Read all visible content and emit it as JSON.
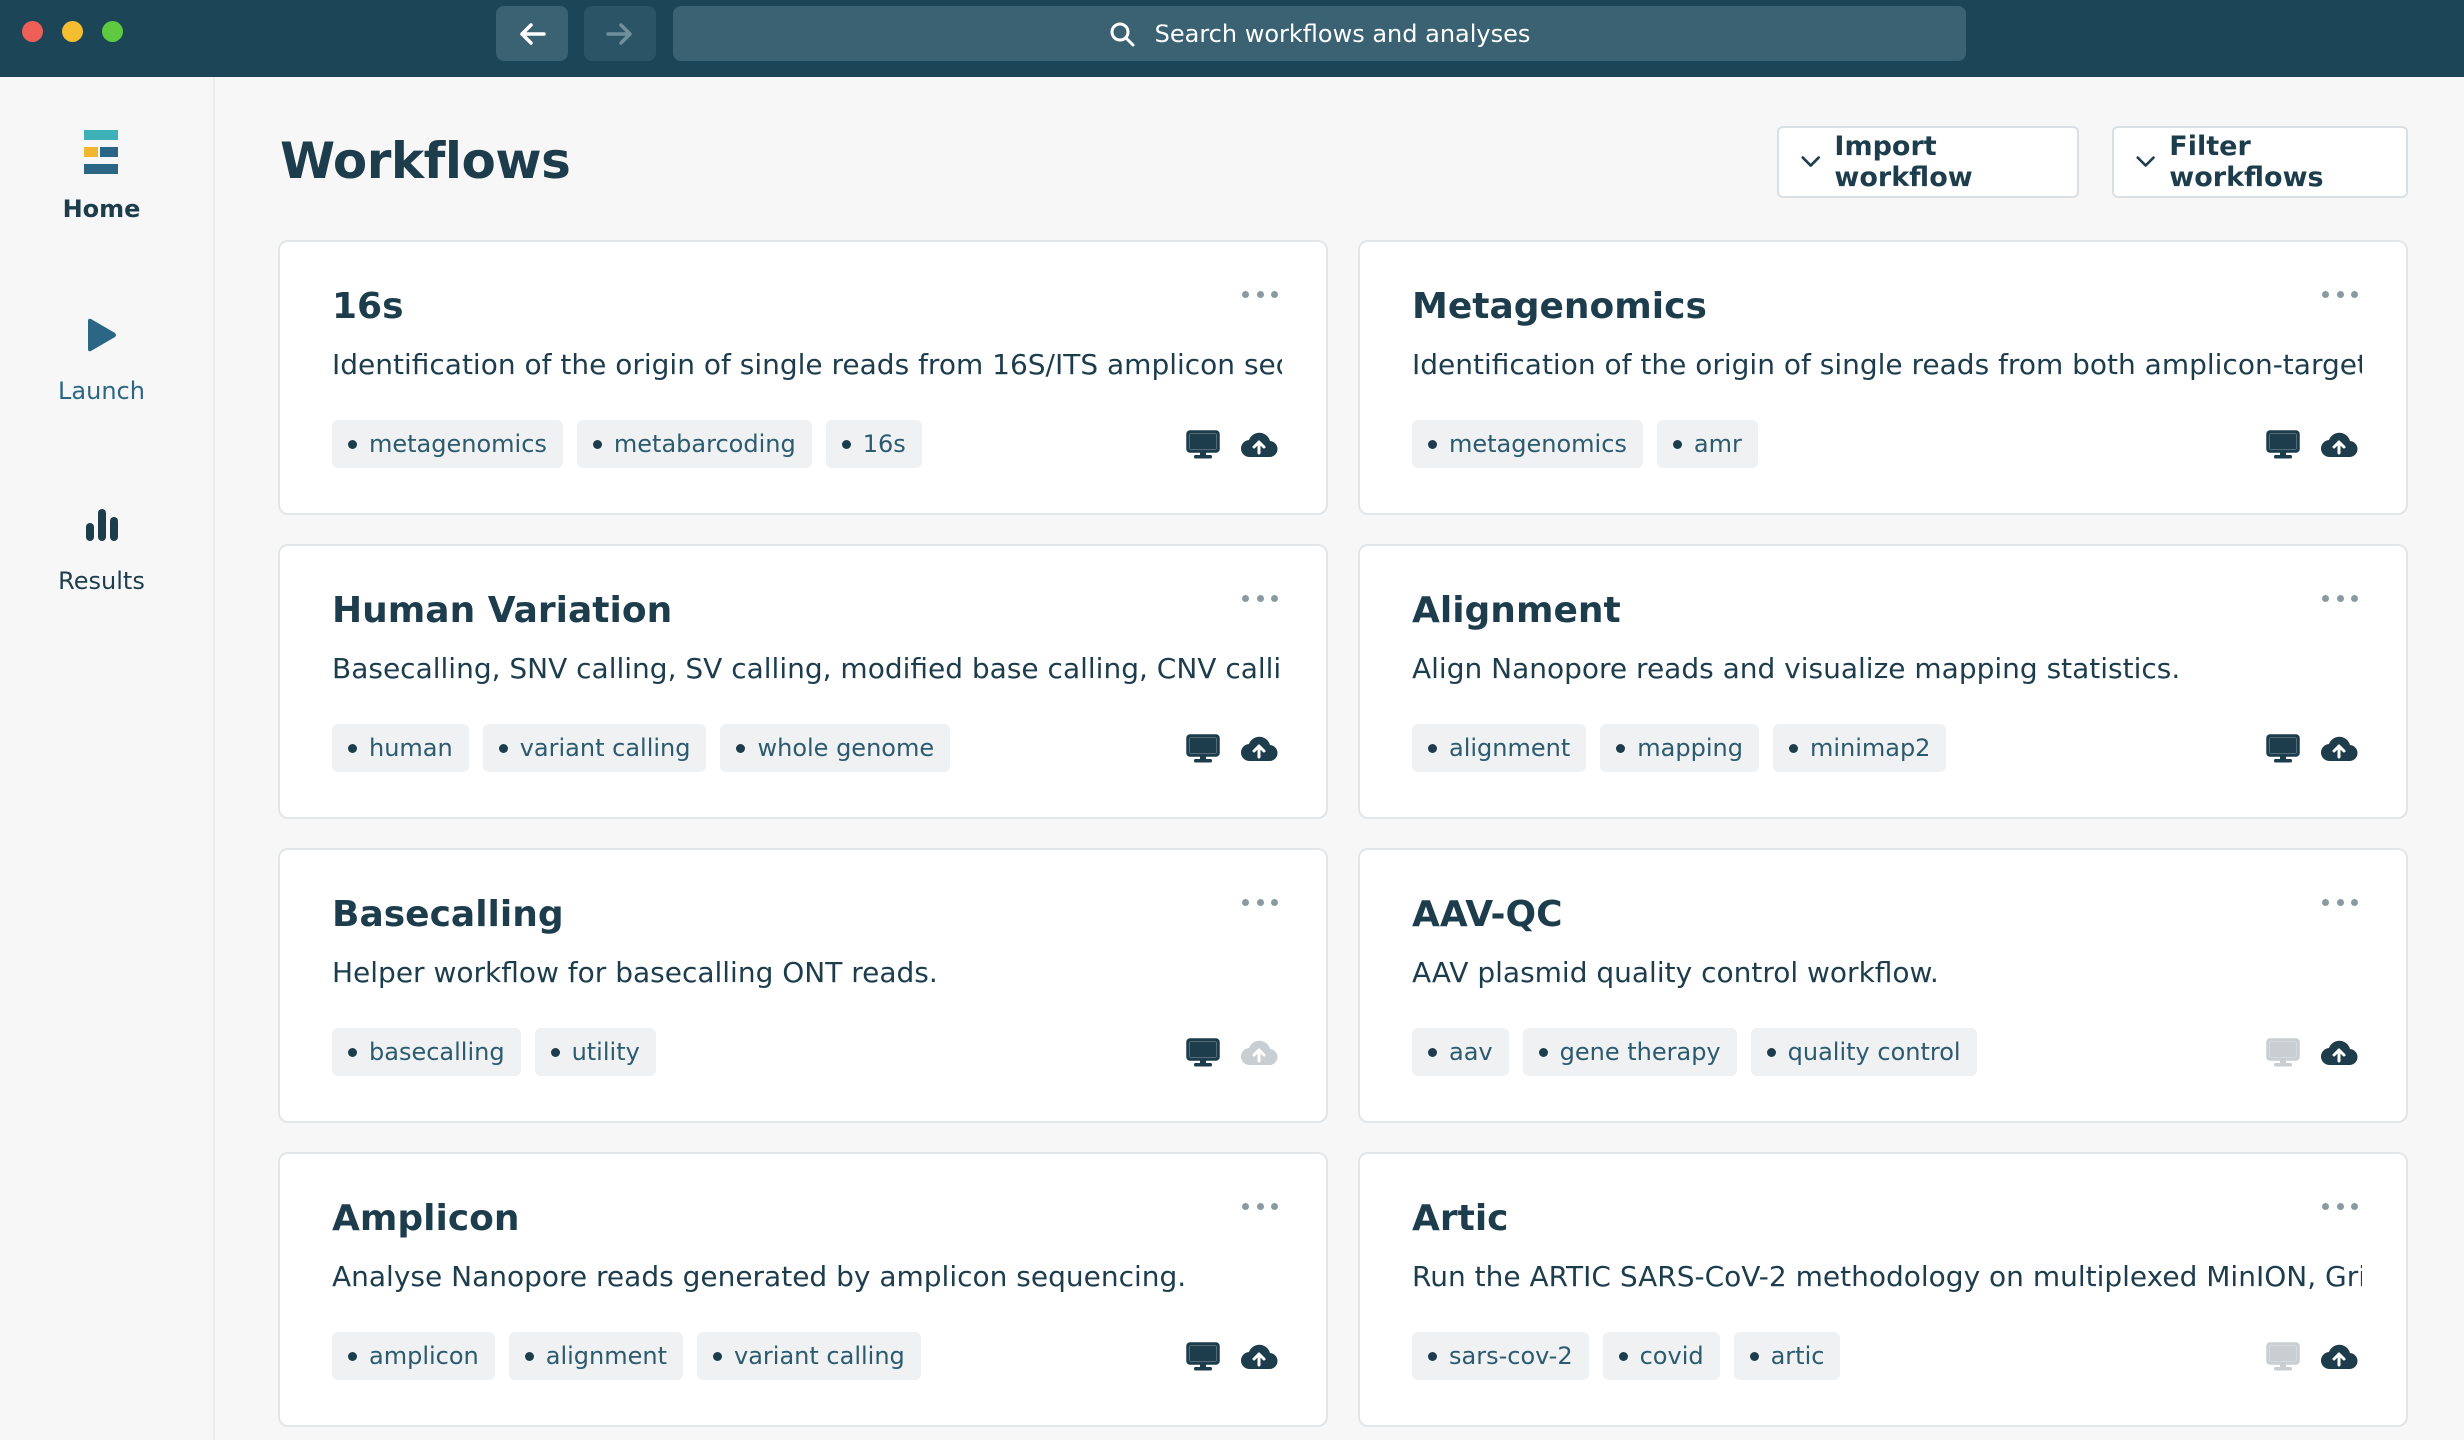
{
  "search": {
    "placeholder": "Search workflows and analyses"
  },
  "sidebar": {
    "items": [
      {
        "label": "Home"
      },
      {
        "label": "Launch"
      },
      {
        "label": "Results"
      }
    ]
  },
  "header": {
    "title": "Workflows",
    "import_label": "Import workflow",
    "filter_label": "Filter workflows"
  },
  "colors": {
    "titlebar": "#1c4658",
    "accent": "#2c6685",
    "text": "#1d3d4d",
    "disabled_icon": "#c8ced1"
  },
  "workflows": [
    {
      "title": "16s",
      "description": "Identification of the origin of single reads from 16S/ITS amplicon seq...",
      "tags": [
        "metagenomics",
        "metabarcoding",
        "16s"
      ],
      "local_enabled": true,
      "cloud_enabled": true
    },
    {
      "title": "Metagenomics",
      "description": "Identification of the origin of single reads from both amplicon-target...",
      "tags": [
        "metagenomics",
        "amr"
      ],
      "local_enabled": true,
      "cloud_enabled": true
    },
    {
      "title": "Human Variation",
      "description": "Basecalling, SNV calling, SV calling, modified base calling, CNV calli...",
      "tags": [
        "human",
        "variant calling",
        "whole genome"
      ],
      "local_enabled": true,
      "cloud_enabled": true
    },
    {
      "title": "Alignment",
      "description": "Align Nanopore reads and visualize mapping statistics.",
      "tags": [
        "alignment",
        "mapping",
        "minimap2"
      ],
      "local_enabled": true,
      "cloud_enabled": true
    },
    {
      "title": "Basecalling",
      "description": "Helper workflow for basecalling ONT reads.",
      "tags": [
        "basecalling",
        "utility"
      ],
      "local_enabled": true,
      "cloud_enabled": false
    },
    {
      "title": "AAV-QC",
      "description": "AAV plasmid quality control workflow.",
      "tags": [
        "aav",
        "gene therapy",
        "quality control"
      ],
      "local_enabled": false,
      "cloud_enabled": true
    },
    {
      "title": "Amplicon",
      "description": "Analyse Nanopore reads generated by amplicon sequencing.",
      "tags": [
        "amplicon",
        "alignment",
        "variant calling"
      ],
      "local_enabled": true,
      "cloud_enabled": true
    },
    {
      "title": "Artic",
      "description": "Run the ARTIC SARS-CoV-2 methodology on multiplexed MinION, Gri...",
      "tags": [
        "sars-cov-2",
        "covid",
        "artic"
      ],
      "local_enabled": false,
      "cloud_enabled": true
    }
  ]
}
